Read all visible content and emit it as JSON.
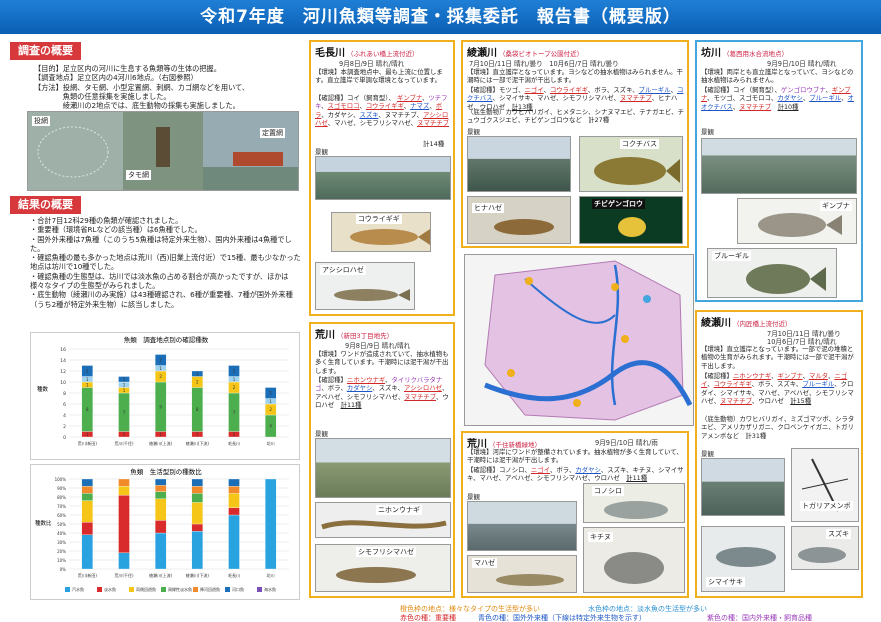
{
  "banner": {
    "title": "令和7年度　河川魚類等調査・採集委託　報告書（概要版）"
  },
  "overview": {
    "header": "調査の概要",
    "lines": [
      "【目的】足立区内の河川に生息する魚類等の生体の把握。",
      "【調査地点】足立区内の4河川6地点。（右図参照）",
      "【方法】投網、タモ網、小型定置網、刺網、カゴ網などを用いて、",
      "　　　　魚類の任意採集を実施しました。",
      "　　　　綾瀬川の2地点では、底生動物の採集も実施しました。"
    ],
    "photo_labels": [
      "投網",
      "タモ網",
      "定置網"
    ]
  },
  "results": {
    "header": "結果の概要",
    "bullets": [
      "合計7目12科29種の魚類が確認されました。",
      "重要種（環境省RLなどの該当種）は6魚種でした。",
      "国外外来種は7魚種（このうち5魚種は特定外来生物）、国内外来種は4魚種でした。",
      "確認魚種の最も多かった地点は荒川（西)旧業上流付近）で15種、最も少なかった地点は坊川で10種でした。",
      "確認魚種の生態型は、坊川では淡水魚の占める割合が高かったですが、ほかは様々なタイプの生態型がみられました。",
      "底生動物（綾瀬川のみ実施）は43種確認され、6種が重要種、7種が国外外来種（うち2種が特定外来生物）に該当しました。"
    ]
  },
  "chart1": {
    "chart_data": {
      "type": "bar",
      "title": "魚類　調査地点別の確認種数",
      "ylabel": "種数",
      "ylim": [
        0,
        16
      ],
      "yticks": [
        0,
        2,
        4,
        6,
        8,
        10,
        12,
        14,
        16
      ],
      "categories": [
        "荒川(新田)",
        "荒川(千住)",
        "綾瀬川(上流)",
        "綾瀬川(下流)",
        "毛長川",
        "坊川"
      ],
      "series": [
        {
          "color": "#d92b2b",
          "values": [
            1,
            1,
            1,
            1,
            1,
            0
          ]
        },
        {
          "color": "#4cae4c",
          "values": [
            8,
            7,
            9,
            8,
            7,
            4
          ]
        },
        {
          "color": "#f5c518",
          "values": [
            1,
            1,
            2,
            2,
            2,
            2
          ]
        },
        {
          "color": "#9fd3ef",
          "values": [
            1,
            1,
            1,
            0,
            1,
            1
          ]
        },
        {
          "color": "#1a6fb8",
          "values": [
            2,
            1,
            2,
            1,
            2,
            2
          ]
        }
      ],
      "totals": [
        13,
        11,
        15,
        12,
        13,
        10
      ]
    }
  },
  "chart2": {
    "chart_data": {
      "type": "bar",
      "title": "魚類　生活型別の種数比",
      "ylabel": "種数比",
      "ylim": [
        0,
        100
      ],
      "yticks": [
        "0%",
        "10%",
        "20%",
        "30%",
        "40%",
        "50%",
        "60%",
        "70%",
        "80%",
        "90%",
        "100%"
      ],
      "categories": [
        "荒川(新田)",
        "荒川(千住)",
        "綾瀬川(上流)",
        "綾瀬川(下流)",
        "毛長川",
        "坊川"
      ],
      "series": [
        {
          "name": "汽水魚",
          "color": "#29a3e0",
          "values": [
            38,
            18,
            40,
            42,
            60,
            100
          ]
        },
        {
          "name": "淡水魚",
          "color": "#d92b2b",
          "values": [
            14,
            64,
            14,
            8,
            8,
            0
          ]
        },
        {
          "name": "両側回遊魚",
          "color": "#f5c518",
          "values": [
            24,
            10,
            24,
            24,
            16,
            0
          ]
        },
        {
          "name": "周縁性淡水魚",
          "color": "#4cae4c",
          "values": [
            8,
            0,
            8,
            10,
            0,
            0
          ]
        },
        {
          "name": "降河回遊魚",
          "color": "#f08a2b",
          "values": [
            8,
            8,
            7,
            8,
            8,
            0
          ]
        },
        {
          "name": "河口魚",
          "color": "#1a6fb8",
          "values": [
            8,
            0,
            7,
            8,
            8,
            0
          ]
        }
      ],
      "legend": [
        "汽水魚",
        "淡水魚",
        "両側回遊魚",
        "周縁性淡水魚",
        "降河回遊魚",
        "河口魚",
        "海水魚"
      ]
    }
  },
  "stations": {
    "kenaga": {
      "title": "毛長川",
      "sub": "（ふれあい橋上流付近）",
      "date": "9月8日/9日 晴れ/晴れ",
      "env": "【環境】本調査地点中、最も上流に位置します。直立護岸で単調な環境となっています。",
      "species_prefix": "【確認種】コイ（飼育型）、",
      "species": [
        "ギンブナ",
        "ツチフキ",
        "スゴモロコ",
        "コウライギギ",
        "ナマズ",
        "ボラ",
        "カダヤシ",
        "スズキ",
        "ヌマチチブ",
        "アシシロハゼ",
        "マハゼ",
        "シモフリシマハゼ",
        "ヌマチチブ"
      ],
      "count": "計14種",
      "photo_labels": [
        "景観",
        "コウライギギ",
        "アシシロハゼ"
      ]
    },
    "ayase_up": {
      "title": "綾瀬川",
      "sub": "（桑袋ビオトープ公園付近）",
      "date": "7月10日/11日 晴れ/曇り　10月6日/7日 晴れ/曇り",
      "env": "【環境】直立護岸となっています。ヨシなどの抽水植物はみられません。干潮時には一部で泥干潟が干出します。",
      "species_prefix": "【確認種】モツゴ、",
      "species": [
        "ニゴイ",
        "コウライギギ",
        "ボラ",
        "スズキ",
        "ブルーギル",
        "コクチバス",
        "シマイサキ",
        "マハゼ",
        "シモフリシマハゼ",
        "ヌマチチブ",
        "ヒナハゼ",
        "ウロハゼ"
      ],
      "count": "計13種",
      "benthos": "（底生動物）カワヒバリガイ、ヒメタニシ、シナヌマエビ、テナガエビ、チュウゴクスジエビ、チビゲンゴロウなど　計27種",
      "photo_labels": [
        "景観",
        "コクチバス",
        "ヒナハゼ",
        "チビゲンゴロウ"
      ]
    },
    "bogawa": {
      "title": "坊川",
      "sub": "（葛西用水合流地点）",
      "date": "9月9日/10日 晴れ/晴れ",
      "env": "【環境】両岸とも直立護岸となっていて、ヨシなどの抽水植物はみられません。",
      "species_prefix": "【確認種】コイ（飼育型）、",
      "species": [
        "ゲンゴロウブナ",
        "ギンブナ",
        "モツゴ",
        "スゴモロコ",
        "カダヤシ",
        "ブルーギル",
        "オオクチバス",
        "ヌマチチブ"
      ],
      "count": "計10種",
      "photo_labels": [
        "景観",
        "ギンブナ",
        "ブルーギル"
      ]
    },
    "arakawa_nitta": {
      "title": "荒川",
      "sub": "（新田3丁目地先）",
      "date": "9月8日/9日 晴れ/晴れ",
      "env": "【環境】ワンドが造成されていて、抽水植物も多く生育しています。干潮時には泥干潟が干出します。",
      "species_prefix": "【確認種】",
      "species": [
        "ニホンウナギ",
        "タイリクバラタナゴ",
        "ボラ",
        "カダヤシ",
        "スズキ",
        "アシシロハゼ",
        "アベハゼ",
        "シモフリシマハゼ",
        "ヌマチチブ",
        "ウロハゼ"
      ],
      "count": "計11種",
      "photo_labels": [
        "景観",
        "ニホンウナギ",
        "シモフリシマハゼ"
      ]
    },
    "arakawa_senju": {
      "title": "荒川",
      "sub": "（千住新橋緑地）",
      "date": "9月9日/10日 晴れ/雨",
      "env": "【環境】河岸にワンドが整備されています。抽水植物が多く生育していて、干潮時には泥干潟が干出します。",
      "species_prefix": "【確認種】コノシロ、",
      "species": [
        "ニゴイ",
        "ボラ",
        "カダヤシ",
        "スズキ",
        "キチヌ",
        "シマイサキ",
        "マハゼ",
        "アベハゼ",
        "シモフリシマハゼ",
        "ウロハゼ"
      ],
      "count": "計11種",
      "photo_labels": [
        "景観",
        "コノシロ",
        "キチヌ",
        "マハゼ"
      ]
    },
    "ayase_down": {
      "title": "綾瀬川",
      "sub": "（内匠橋上流付近）",
      "date1": "7月10日/11日 晴れ/曇り",
      "date2": "10月6日/7日 晴れ/晴れ",
      "env": "【環境】直立護岸となっています。一部で泥の堆積と植物の生育がみられます。干潮時には一部で泥干潟が干出します。",
      "species_prefix": "【確認種】",
      "species": [
        "ニホンウナギ",
        "ギンブナ",
        "マルタ",
        "ニゴイ",
        "コウライギギ",
        "ボラ",
        "スズキ",
        "ブルーギル",
        "クロダイ",
        "シマイサキ",
        "マハゼ",
        "アベハゼ",
        "シモフリシマハゼ",
        "ヌマチチブ",
        "ウロハゼ"
      ],
      "count": "計15種",
      "benthos": "（底生動物）カワヒバリガイ、ミズゴマツボ、シラタエビ、アメリカザリガニ、クロベンケイガニ、トガリアメンボなど　計31種",
      "photo_labels": [
        "景観",
        "トガリアメンボ",
        "スズキ",
        "シマイサキ"
      ]
    }
  },
  "footer": {
    "line1a": "橙色枠の地点：様々なタイプの生活型が多い",
    "line1b": "水色枠の地点：淡水魚の生活型が多い",
    "line2a": "赤色の種：重要種",
    "line2b": "青色の種：国外外来種（下線は特定外来生物を示す）",
    "line2c": "紫色の種：国内外来種・飼育品種"
  },
  "colors": {
    "banner": "#0a5fb4",
    "section": "#d7383b",
    "orange_frame": "#f0b01b",
    "blue_frame": "#43a6df",
    "important": "#d42727",
    "alien": "#1c55c6",
    "domestic": "#9a3ab8"
  }
}
